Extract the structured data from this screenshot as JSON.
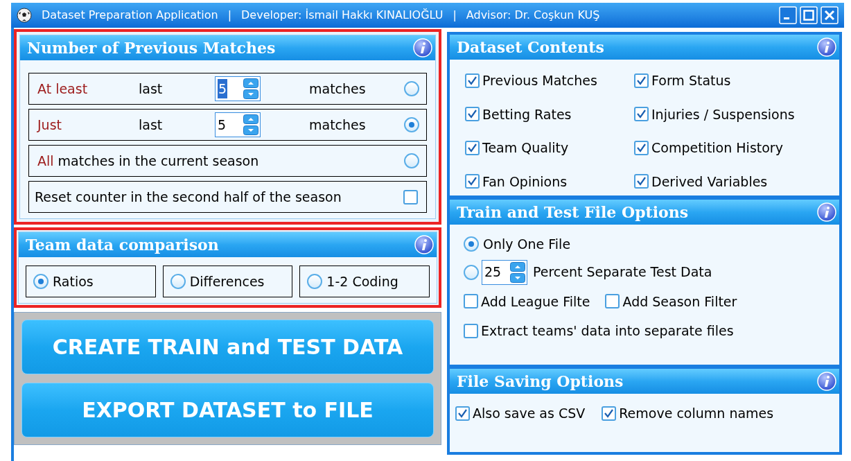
{
  "window": {
    "title_parts": [
      "Dataset Preparation Application",
      "|",
      "Developer: İsmail Hakkı KINALIOĞLU",
      "|",
      "Advisor: Dr. Coşkun KUŞ"
    ]
  },
  "previous_matches": {
    "title": "Number of Previous Matches",
    "rows": [
      {
        "kind": "count",
        "lead": "At least",
        "word": "last",
        "value": "5",
        "value_highlighted": true,
        "unit": "matches",
        "selected": false
      },
      {
        "kind": "count",
        "lead": "Just",
        "word": "last",
        "value": "5",
        "value_highlighted": false,
        "unit": "matches",
        "selected": true
      },
      {
        "kind": "all",
        "lead": "All",
        "text": "matches in the current season",
        "selected": false
      },
      {
        "kind": "checkbox",
        "text": "Reset counter in the second half of the season",
        "checked": false
      }
    ]
  },
  "team_comparison": {
    "title": "Team data comparison",
    "options": [
      {
        "label": "Ratios",
        "selected": true
      },
      {
        "label": "Differences",
        "selected": false
      },
      {
        "label": "1-2 Coding",
        "selected": false
      }
    ]
  },
  "actions": [
    "CREATE TRAIN and TEST DATA",
    "EXPORT DATASET to FILE"
  ],
  "dataset_contents": {
    "title": "Dataset Contents",
    "items": [
      {
        "label": "Previous Matches",
        "checked": true
      },
      {
        "label": "Form Status",
        "checked": true
      },
      {
        "label": "Betting Rates",
        "checked": true
      },
      {
        "label": "Injuries / Suspensions",
        "checked": true
      },
      {
        "label": "Team Quality",
        "checked": true
      },
      {
        "label": "Competition History",
        "checked": true
      },
      {
        "label": "Fan Opinions",
        "checked": true
      },
      {
        "label": "Derived Variables",
        "checked": true
      }
    ]
  },
  "train_test": {
    "title": "Train and Test File Options",
    "options": [
      {
        "kind": "radio",
        "label": "Only One File",
        "selected": true
      },
      {
        "kind": "radio_spinner",
        "value": "25",
        "label": "Percent Separate Test Data",
        "selected": false
      }
    ],
    "filters": [
      {
        "label": "Add League Filte",
        "checked": false
      },
      {
        "label": "Add Season Filter",
        "checked": false
      }
    ],
    "extract": {
      "label": "Extract teams' data into separate files",
      "checked": false
    }
  },
  "file_saving": {
    "title": "File Saving Options",
    "items": [
      {
        "label": "Also save as CSV",
        "checked": true
      },
      {
        "label": "Remove column names",
        "checked": true
      }
    ]
  }
}
